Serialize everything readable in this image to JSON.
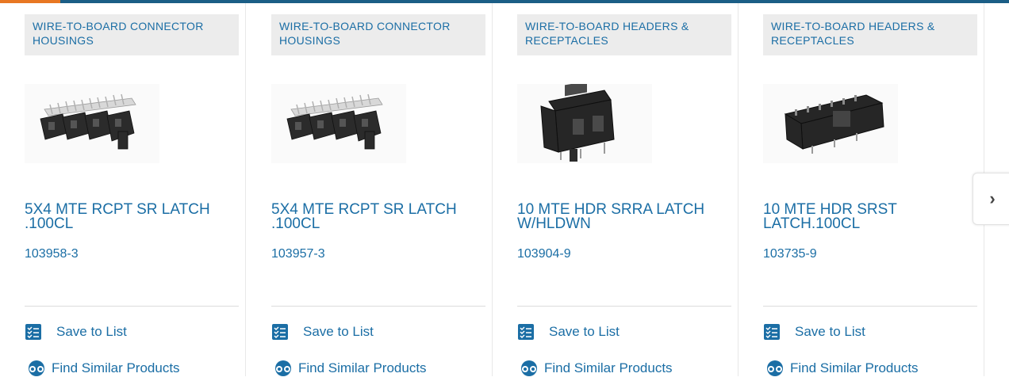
{
  "brand": {
    "accent": "#e87722",
    "primary": "#1b5e86",
    "link": "#1b6ea5"
  },
  "products": [
    {
      "category": "WIRE-TO-BOARD CONNECTOR HOUSINGS",
      "title": "5X4 MTE RCPT SR LATCH .100CL",
      "part_number": "103958-3",
      "image": "housing-strip"
    },
    {
      "category": "WIRE-TO-BOARD CONNECTOR HOUSINGS",
      "title": "5X4 MTE RCPT SR LATCH .100CL",
      "part_number": "103957-3",
      "image": "housing-strip"
    },
    {
      "category": "WIRE-TO-BOARD HEADERS & RECEPTACLES",
      "title": "10 MTE HDR SRRA LATCH W/HLDWN",
      "part_number": "103904-9",
      "image": "right-angle-header"
    },
    {
      "category": "WIRE-TO-BOARD HEADERS & RECEPTACLES",
      "title": "10 MTE HDR SRST LATCH.100CL",
      "part_number": "103735-9",
      "image": "straight-header"
    }
  ],
  "actions": {
    "save_label": "Save to List",
    "save_icon": "checklist-icon",
    "similar_label": "Find Similar Products",
    "similar_icon": "binoculars-icon"
  },
  "carousel": {
    "next_icon": "chevron-right-icon",
    "next_glyph": "›"
  }
}
